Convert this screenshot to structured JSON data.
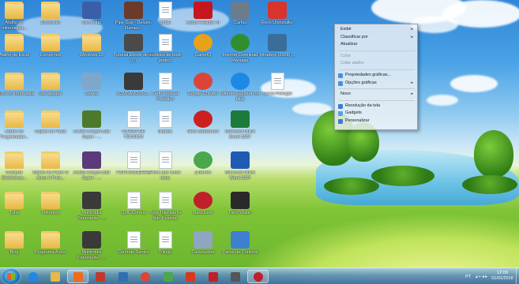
{
  "desktop": {
    "icons": [
      {
        "label": "Atalho do Informática...",
        "kind": "folder",
        "color": "#e9b846",
        "col": 0,
        "row": 0
      },
      {
        "label": "Economix",
        "kind": "folder",
        "color": "#e9b846",
        "col": 1,
        "row": 0
      },
      {
        "label": "Win setup",
        "kind": "app",
        "color": "#3b5ea8",
        "col": 2,
        "row": 0
      },
      {
        "label": "Pipe Guy - Deluxe, Flames...",
        "kind": "app",
        "color": "#6b3a2a",
        "col": 3,
        "row": 0
      },
      {
        "label": "email",
        "kind": "doc",
        "color": "#ffffff",
        "col": 4,
        "row": 0
      },
      {
        "label": "Adobe Reader XI",
        "kind": "app",
        "color": "#c4161c",
        "col": 5,
        "row": 0
      },
      {
        "label": "Carlos",
        "kind": "app",
        "color": "#6e7b8b",
        "col": 6,
        "row": 0
      },
      {
        "label": "Revo Uninstaller",
        "kind": "app",
        "color": "#d9332e",
        "col": 7,
        "row": 0
      },
      {
        "label": "Atalho de Excel",
        "kind": "folder",
        "color": "#e9b846",
        "col": 0,
        "row": 1
      },
      {
        "label": "Louvemed",
        "kind": "folder",
        "color": "#e9b846",
        "col": 1,
        "row": 1
      },
      {
        "label": "Windows 10",
        "kind": "folder",
        "color": "#e9b846",
        "col": 2,
        "row": 1
      },
      {
        "label": "Tutorial Ebook de cv (...)",
        "kind": "app",
        "color": "#4a4a4a",
        "col": 3,
        "row": 1
      },
      {
        "label": "modelos de book gráfico",
        "kind": "doc",
        "color": "#ffffff",
        "col": 4,
        "row": 1
      },
      {
        "label": "GameIQ",
        "kind": "round",
        "color": "#e8a21a",
        "col": 5,
        "row": 1
      },
      {
        "label": "Internet Download Manager",
        "kind": "round",
        "color": "#2f8f2f",
        "col": 6,
        "row": 1
      },
      {
        "label": "Intruders (2008) ...",
        "kind": "app",
        "color": "#3a6d9a",
        "col": 7,
        "row": 1
      },
      {
        "label": "Atalho do informática",
        "kind": "folder",
        "color": "#e9b846",
        "col": 0,
        "row": 2
      },
      {
        "label": "não apague",
        "kind": "folder",
        "color": "#e9b846",
        "col": 1,
        "row": 2
      },
      {
        "label": "Lixeira",
        "kind": "app",
        "color": "#7fa7c9",
        "col": 2,
        "row": 2
      },
      {
        "label": "XOMSAUDIO-2...",
        "kind": "app",
        "color": "#3a3a3a",
        "col": 3,
        "row": 2
      },
      {
        "label": "Perfil Pessoal ProEdico",
        "kind": "doc",
        "color": "#ffffff",
        "col": 4,
        "row": 2
      },
      {
        "label": "Google Chrome",
        "kind": "round",
        "color": "#db4437",
        "col": 5,
        "row": 2
      },
      {
        "label": "Internet Explorer (64 bits)",
        "kind": "round",
        "color": "#1e88e5",
        "col": 6,
        "row": 2
      },
      {
        "label": "Curso Portugal",
        "kind": "doc",
        "color": "#ffffff",
        "col": 7,
        "row": 2
      },
      {
        "label": "Atalho do Programador...",
        "kind": "folder",
        "color": "#e9b846",
        "col": 0,
        "row": 3
      },
      {
        "label": "Objeto do Paulo",
        "kind": "folder",
        "color": "#e9b846",
        "col": 1,
        "row": 3
      },
      {
        "label": "Ardeia Dragon Ball Super - ...",
        "kind": "app",
        "color": "#4d7a2a",
        "col": 2,
        "row": 3
      },
      {
        "label": "CURSO DE TECNICO",
        "kind": "doc",
        "color": "#ffffff",
        "col": 3,
        "row": 3
      },
      {
        "label": "tikanda",
        "kind": "doc",
        "color": "#ffffff",
        "col": 4,
        "row": 3
      },
      {
        "label": "Nero StartSmart",
        "kind": "round",
        "color": "#cc1f1f",
        "col": 5,
        "row": 3
      },
      {
        "label": "Microsoft Office Excel 2007",
        "kind": "app",
        "color": "#1d7a3a",
        "col": 6,
        "row": 3
      },
      {
        "label": "Comprar Eletrônicos...",
        "kind": "folder",
        "color": "#e9b846",
        "col": 0,
        "row": 4
      },
      {
        "label": "Objeto do Paulo O Amor é Pura...",
        "kind": "folder",
        "color": "#e9b846",
        "col": 1,
        "row": 4
      },
      {
        "label": "Ardeia Dragon Ball Super - ...",
        "kind": "app",
        "color": "#5a3a7a",
        "col": 2,
        "row": 4
      },
      {
        "label": "PORTUGUERRA",
        "kind": "doc",
        "color": "#ffffff",
        "col": 3,
        "row": 4
      },
      {
        "label": "Ficha que nome nova",
        "kind": "doc",
        "color": "#ffffff",
        "col": 4,
        "row": 4
      },
      {
        "label": "µTorrent",
        "kind": "round",
        "color": "#4aa84a",
        "col": 5,
        "row": 4
      },
      {
        "label": "Microsoft Office Word 2007",
        "kind": "app",
        "color": "#1f5bb5",
        "col": 6,
        "row": 4
      },
      {
        "label": "Tube",
        "kind": "folder",
        "color": "#e9b846",
        "col": 0,
        "row": 5
      },
      {
        "label": "Pokemon",
        "kind": "folder",
        "color": "#e9b846",
        "col": 1,
        "row": 5
      },
      {
        "label": "Multimídia Panoneote - ...",
        "kind": "app",
        "color": "#3a3a3a",
        "col": 2,
        "row": 5
      },
      {
        "label": "GMF Correio",
        "kind": "doc",
        "color": "#ffffff",
        "col": 3,
        "row": 5
      },
      {
        "label": "Teste Intelligente Não Pessoal",
        "kind": "doc",
        "color": "#ffffff",
        "col": 4,
        "row": 5
      },
      {
        "label": "Bandicam",
        "kind": "round",
        "color": "#c0202a",
        "col": 5,
        "row": 5
      },
      {
        "label": "Nero Vision",
        "kind": "app",
        "color": "#2a2a2a",
        "col": 6,
        "row": 5
      },
      {
        "label": "Blog",
        "kind": "folder",
        "color": "#e9b846",
        "col": 0,
        "row": 6
      },
      {
        "label": "Programa Áudio",
        "kind": "folder",
        "color": "#e9b846",
        "col": 1,
        "row": 6
      },
      {
        "label": "Multimídia Panoneote - ...",
        "kind": "app",
        "color": "#3a3a3a",
        "col": 2,
        "row": 6
      },
      {
        "label": "Contrato Santos",
        "kind": "doc",
        "color": "#ffffff",
        "col": 3,
        "row": 6
      },
      {
        "label": "Trilogo",
        "kind": "doc",
        "color": "#ffffff",
        "col": 4,
        "row": 6
      },
      {
        "label": "Calculadora",
        "kind": "app",
        "color": "#8fa6c0",
        "col": 5,
        "row": 6
      },
      {
        "label": "Painel de Controle",
        "kind": "app",
        "color": "#3f7fd0",
        "col": 6,
        "row": 6
      }
    ]
  },
  "context_menu": {
    "items": [
      {
        "type": "item",
        "label": "Exibir",
        "submenu": true,
        "disabled": false
      },
      {
        "type": "item",
        "label": "Classificar por",
        "submenu": true,
        "disabled": false
      },
      {
        "type": "item",
        "label": "Atualizar",
        "submenu": false,
        "disabled": false
      },
      {
        "type": "sep"
      },
      {
        "type": "item",
        "label": "Colar",
        "submenu": false,
        "disabled": true
      },
      {
        "type": "item",
        "label": "Colar atalho",
        "submenu": false,
        "disabled": true
      },
      {
        "type": "sep"
      },
      {
        "type": "item",
        "label": "Propriedades gráficas...",
        "submenu": false,
        "disabled": false,
        "icon": "#4a90d9"
      },
      {
        "type": "item",
        "label": "Opções gráficas",
        "submenu": true,
        "disabled": false,
        "icon": "#4a90d9"
      },
      {
        "type": "sep"
      },
      {
        "type": "item",
        "label": "Novo",
        "submenu": true,
        "disabled": false
      },
      {
        "type": "sep"
      },
      {
        "type": "item",
        "label": "Resolução da tela",
        "submenu": false,
        "disabled": false,
        "icon": "#3a7bd5"
      },
      {
        "type": "item",
        "label": "Gadgets",
        "submenu": false,
        "disabled": false,
        "icon": "#5aa0e0"
      },
      {
        "type": "item",
        "label": "Personalizar",
        "submenu": false,
        "disabled": false,
        "icon": "#3a7bd5"
      }
    ]
  },
  "taskbar": {
    "pinned": [
      {
        "name": "ie-icon",
        "color": "#1e88e5"
      },
      {
        "name": "explorer-folder-icon",
        "color": "#e9b846"
      },
      {
        "name": "media-player-icon",
        "color": "#ef6c1a"
      },
      {
        "name": "game-icon",
        "color": "#c0392b"
      },
      {
        "name": "people-icon",
        "color": "#2f6fb5"
      },
      {
        "name": "chrome-icon",
        "color": "#db4437"
      },
      {
        "name": "utorrent-icon",
        "color": "#4aa84a"
      },
      {
        "name": "flash-icon",
        "color": "#d9381e"
      },
      {
        "name": "app-icon",
        "color": "#c0202a"
      },
      {
        "name": "camera-icon",
        "color": "#555555"
      },
      {
        "name": "record-icon",
        "color": "#c0202a"
      }
    ],
    "tray_lang": "PT",
    "clock_time": "12:09",
    "clock_date": "01/01/2016"
  }
}
